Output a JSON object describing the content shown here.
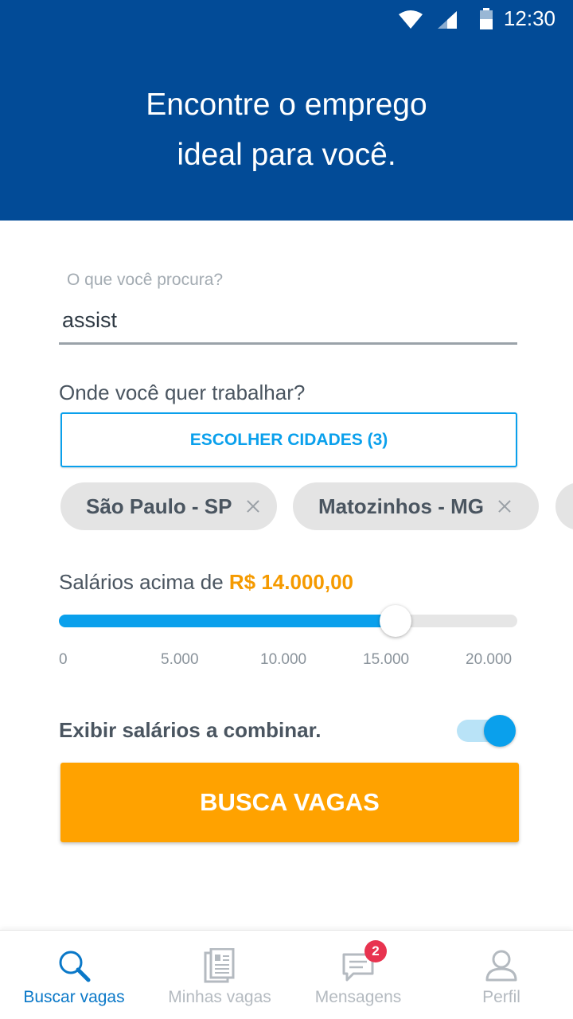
{
  "status_bar": {
    "time": "12:30"
  },
  "header": {
    "line1": "Encontre o emprego",
    "line2": "ideal para você."
  },
  "search": {
    "label": "O que você procura?",
    "value": "assist",
    "placeholder": ""
  },
  "location": {
    "label": "Onde você quer trabalhar?",
    "button_label": "ESCOLHER CIDADES (3)"
  },
  "cities": [
    {
      "label": "São Paulo - SP"
    },
    {
      "label": "Matozinhos - MG"
    }
  ],
  "salary": {
    "prefix": "Salários acima de",
    "value_text": "R$ 14.000,00",
    "value": 14000,
    "min": 0,
    "max": 20000,
    "ticks": [
      "0",
      "5.000",
      "10.000",
      "15.000",
      "20.000"
    ]
  },
  "negotiable": {
    "label": "Exibir salários a combinar.",
    "on": true
  },
  "submit": {
    "label": "BUSCA VAGAS"
  },
  "nav": {
    "items": [
      {
        "label": "Buscar vagas",
        "icon": "search-icon",
        "active": true
      },
      {
        "label": "Minhas vagas",
        "icon": "document-icon",
        "active": false
      },
      {
        "label": "Mensagens",
        "icon": "chat-icon",
        "active": false,
        "badge": "2"
      },
      {
        "label": "Perfil",
        "icon": "user-icon",
        "active": false
      }
    ]
  },
  "colors": {
    "header_bg": "#024b97",
    "accent_blue": "#0aa0ec",
    "accent_orange": "#ffa200",
    "badge_red": "#e8334f"
  }
}
